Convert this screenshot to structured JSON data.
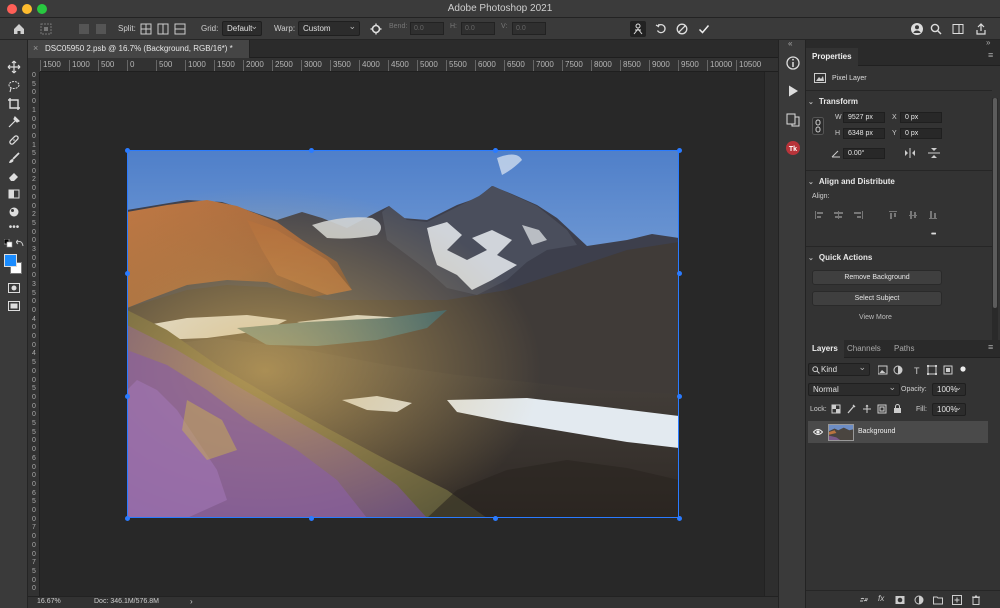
{
  "app": {
    "title": "Adobe Photoshop 2021"
  },
  "options_bar": {
    "split_label": "Split:",
    "grid_label": "Grid:",
    "grid_value": "Default",
    "warp_label": "Warp:",
    "warp_value": "Custom",
    "bend_label": "Bend:",
    "bend_value": "0.0",
    "h_label": "H:",
    "h_value": "0.0",
    "v_label": "V:",
    "v_value": "0.0"
  },
  "document": {
    "tab_label": "DSC05950 2.psb @ 16.7% (Background, RGB/16*) *",
    "close_glyph": "×"
  },
  "rulers": {
    "h_ticks": [
      "1500",
      "1000",
      "500",
      "0",
      "500",
      "1000",
      "1500",
      "2000",
      "2500",
      "3000",
      "3500",
      "4000",
      "4500",
      "5000",
      "5500",
      "6000",
      "6500",
      "7000",
      "7500",
      "8000",
      "8500",
      "9000",
      "9500",
      "10000",
      "10500"
    ],
    "v_ticks": [
      "0",
      "5",
      "0",
      "0",
      "1",
      "0",
      "0",
      "0",
      "1",
      "5",
      "0",
      "0",
      "2",
      "0",
      "0",
      "0",
      "2",
      "5",
      "0",
      "0",
      "3",
      "0",
      "0",
      "0",
      "3",
      "5",
      "0",
      "0",
      "4",
      "0",
      "0",
      "0",
      "4",
      "5",
      "0",
      "0",
      "5",
      "0",
      "0",
      "0",
      "5",
      "5",
      "0",
      "0",
      "6",
      "0",
      "0",
      "0",
      "6",
      "5",
      "0",
      "0",
      "7",
      "0",
      "0",
      "0",
      "7",
      "5",
      "0",
      "0"
    ]
  },
  "status_bar": {
    "zoom": "16.67%",
    "doc_info": "Doc: 346.1M/576.8M",
    "arrow": "›"
  },
  "properties": {
    "tab_label": "Properties",
    "layer_type": "Pixel Layer",
    "transform_title": "Transform",
    "w_label": "W",
    "w_value": "9527 px",
    "h_label": "H",
    "h_value": "6348 px",
    "x_label": "X",
    "x_value": "0 px",
    "y_label": "Y",
    "y_value": "0 px",
    "angle_value": "0.00°",
    "align_title": "Align and Distribute",
    "align_label": "Align:",
    "more_glyph": "•••",
    "quick_actions_title": "Quick Actions",
    "remove_bg": "Remove Background",
    "select_subject": "Select Subject",
    "view_more": "View More"
  },
  "layers": {
    "tabs": [
      "Layers",
      "Channels",
      "Paths"
    ],
    "kind_filter": "Kind",
    "blend_mode": "Normal",
    "opacity_label": "Opacity:",
    "opacity_value": "100%",
    "lock_label": "Lock:",
    "fill_label": "Fill:",
    "fill_value": "100%",
    "layer_name": "Background"
  },
  "colors": {
    "accent": "#2a7bff",
    "foreground_swatch": "#1a8cff",
    "background_swatch": "#ffffff"
  }
}
